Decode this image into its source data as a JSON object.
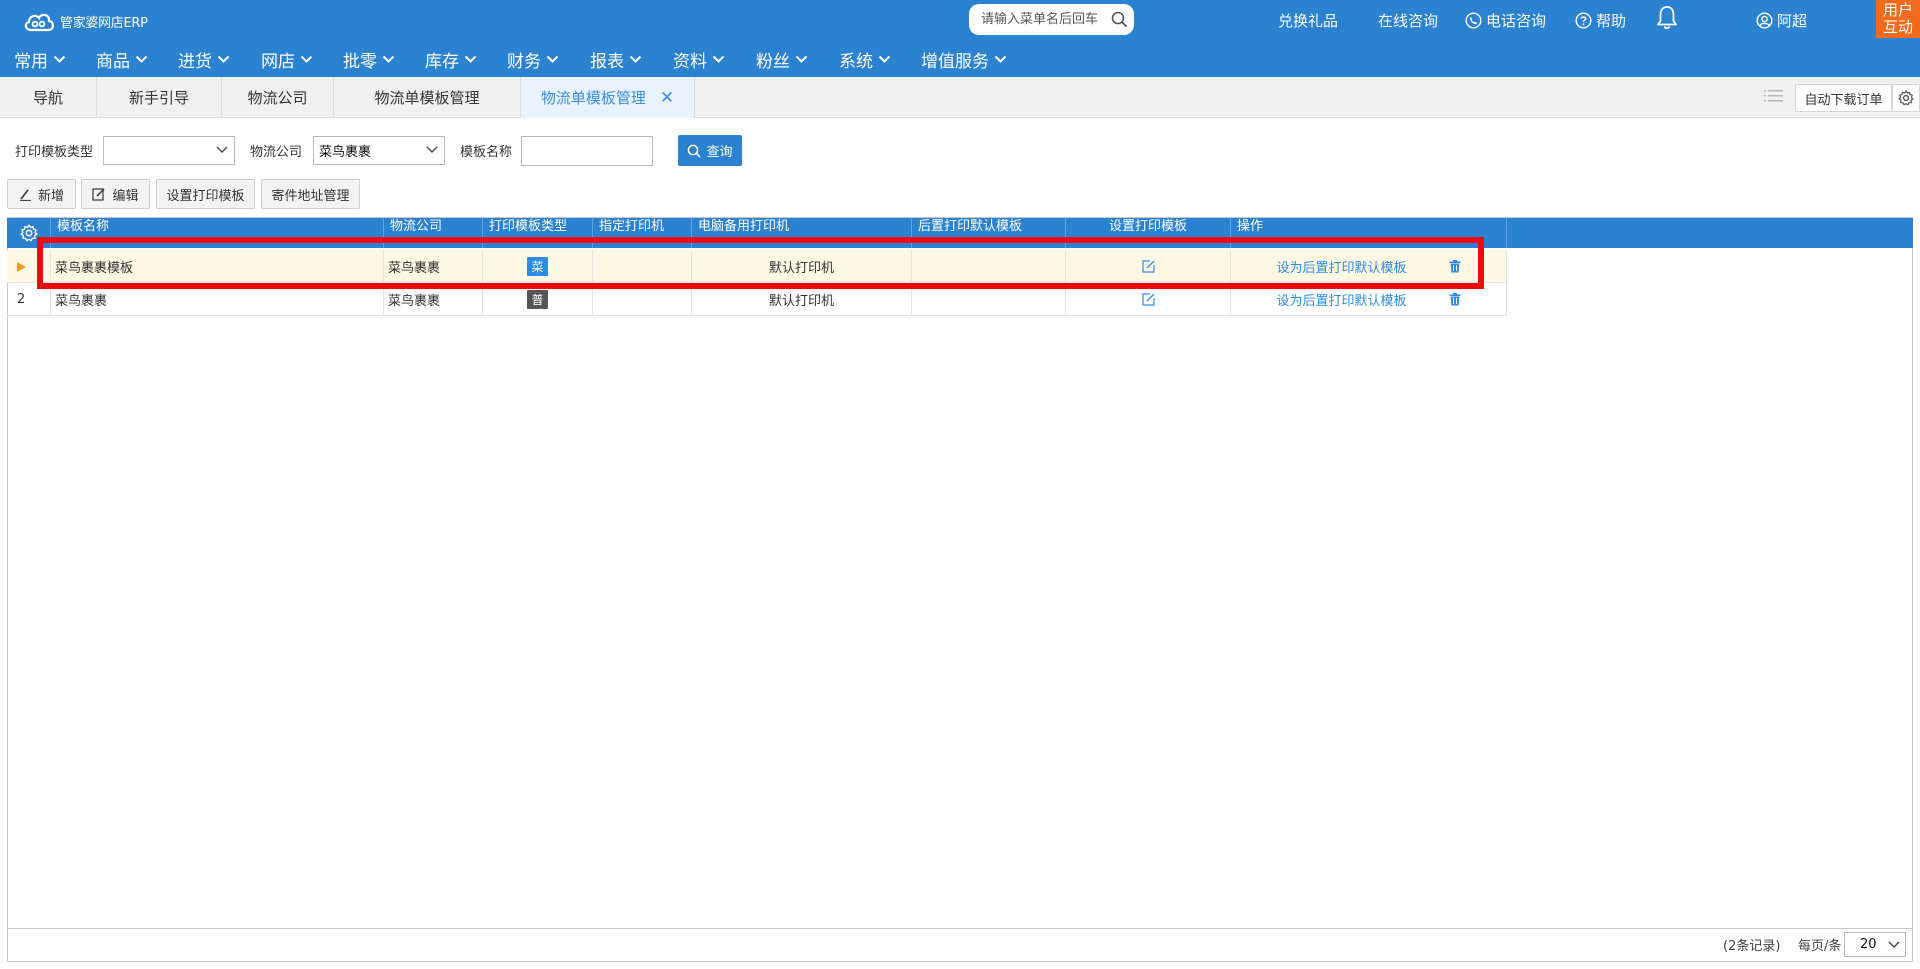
{
  "app": {
    "logo_text": "管家婆网店ERP"
  },
  "header": {
    "search_placeholder": "请输入菜单名后回车",
    "gift": "兑换礼品",
    "online_consult": "在线咨询",
    "phone_consult": "电话咨询",
    "help": "帮助",
    "user_name": "阿超",
    "user_interact": "用户互动"
  },
  "menu": [
    "常用",
    "商品",
    "进货",
    "网店",
    "批零",
    "库存",
    "财务",
    "报表",
    "资料",
    "粉丝",
    "系统",
    "增值服务"
  ],
  "tabs": [
    {
      "label": "导航"
    },
    {
      "label": "新手引导"
    },
    {
      "label": "物流公司"
    },
    {
      "label": "物流单模板管理"
    },
    {
      "label": "物流单模板管理"
    }
  ],
  "tab_actions": {
    "auto_download": "自动下载订单"
  },
  "filters": {
    "template_type_label": "打印模板类型",
    "template_type_value": "",
    "logistics_label": "物流公司",
    "logistics_value": "菜鸟裹裹",
    "template_name_label": "模板名称",
    "template_name_value": "",
    "query_button": "查询"
  },
  "toolbar": {
    "add": "新增",
    "edit": "编辑",
    "set_print_template": "设置打印模板",
    "sender_address": "寄件地址管理"
  },
  "table": {
    "columns": [
      "模板名称",
      "物流公司",
      "打印模板类型",
      "指定打印机",
      "电脑备用打印机",
      "后置打印默认模板",
      "设置打印模板",
      "操作"
    ],
    "rows": [
      {
        "index": "",
        "selected": true,
        "name": "菜鸟裹裹模板",
        "company": "菜鸟裹裹",
        "type_badge": "菜",
        "type_color": "#2d8de6",
        "printer": "",
        "backup_printer": "默认打印机",
        "post_default": "",
        "action_link": "设为后置打印默认模板"
      },
      {
        "index": "2",
        "selected": false,
        "name": "菜鸟裹裹",
        "company": "菜鸟裹裹",
        "type_badge": "普",
        "type_color": "#555555",
        "printer": "",
        "backup_printer": "默认打印机",
        "post_default": "",
        "action_link": "设为后置打印默认模板"
      }
    ]
  },
  "footer": {
    "records": "(2条记录)",
    "per_page_label": "每页/条",
    "per_page_value": "20"
  },
  "colors": {
    "brand_blue": "#2b82d0",
    "highlight_red": "#ec0a0a",
    "user_orange": "#f26a1b",
    "row_selected": "#fdf8e4"
  }
}
